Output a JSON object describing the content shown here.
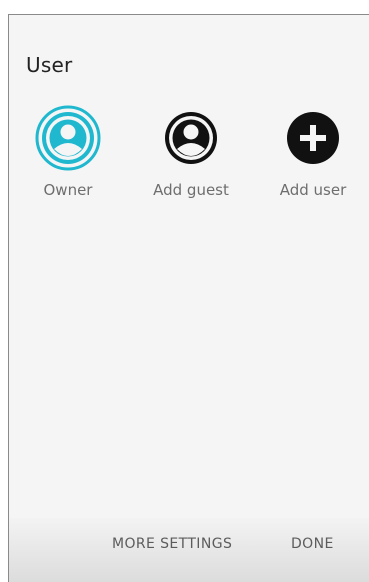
{
  "dialog": {
    "title": "User"
  },
  "users": [
    {
      "label": "Owner",
      "icon": "account-circle-icon",
      "selected": true,
      "accent": "#1fb8cf"
    },
    {
      "label": "Add guest",
      "icon": "account-circle-icon",
      "selected": false,
      "accent": "#111111"
    },
    {
      "label": "Add user",
      "icon": "plus-circle-icon",
      "selected": false,
      "accent": "#111111"
    }
  ],
  "footer": {
    "more_settings_label": "MORE SETTINGS",
    "done_label": "DONE"
  }
}
